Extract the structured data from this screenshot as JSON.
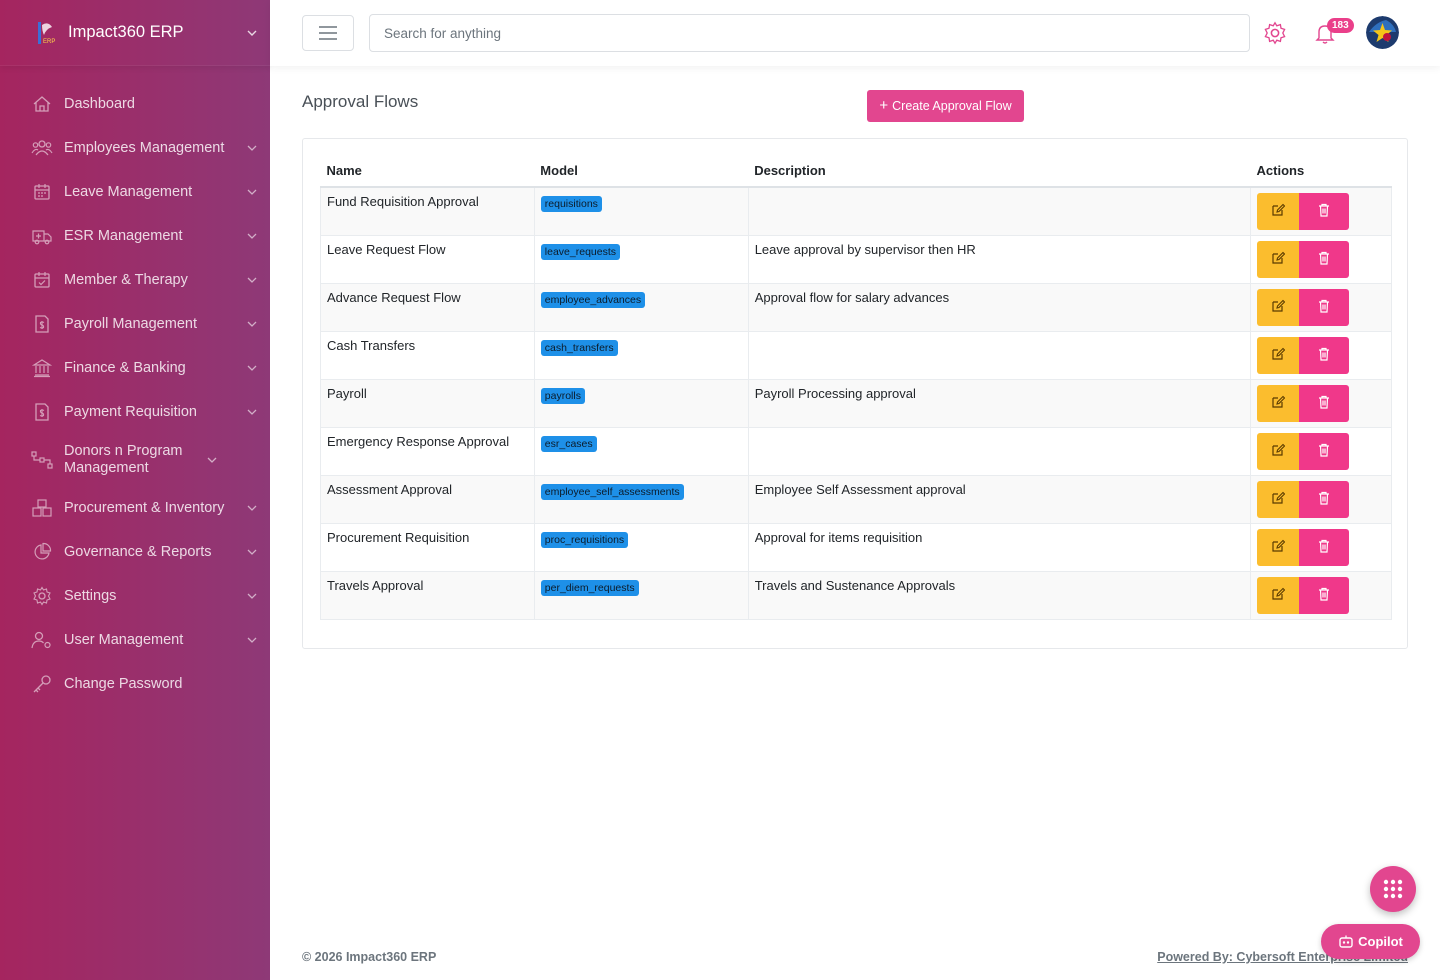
{
  "app": {
    "name": "Impact360 ERP"
  },
  "sidebar": {
    "items": [
      {
        "label": "Dashboard",
        "icon": "home-icon",
        "has_children": false
      },
      {
        "label": "Employees Management",
        "icon": "users-icon",
        "has_children": true
      },
      {
        "label": "Leave Management",
        "icon": "calendar-icon",
        "has_children": true
      },
      {
        "label": "ESR Management",
        "icon": "ambulance-icon",
        "has_children": true
      },
      {
        "label": "Member & Therapy",
        "icon": "calendar-check-icon",
        "has_children": true
      },
      {
        "label": "Payroll Management",
        "icon": "invoice-dollar-icon",
        "has_children": true
      },
      {
        "label": "Finance & Banking",
        "icon": "bank-icon",
        "has_children": true
      },
      {
        "label": "Payment Requisition",
        "icon": "invoice-dollar-icon",
        "has_children": true
      },
      {
        "label": "Donors n Program Management",
        "icon": "hierarchy-icon",
        "has_children": true
      },
      {
        "label": "Procurement & Inventory",
        "icon": "boxes-icon",
        "has_children": true
      },
      {
        "label": "Governance & Reports",
        "icon": "pie-chart-icon",
        "has_children": true
      },
      {
        "label": "Settings",
        "icon": "gear-icon",
        "has_children": true
      },
      {
        "label": "User Management",
        "icon": "user-cog-icon",
        "has_children": true
      },
      {
        "label": "Change Password",
        "icon": "key-icon",
        "has_children": false
      }
    ]
  },
  "topbar": {
    "search_placeholder": "Search for anything",
    "notification_count": "183"
  },
  "main": {
    "title": "Approval Flows",
    "create_button": "Create Approval Flow",
    "table": {
      "headers": [
        "Name",
        "Model",
        "Description",
        "Actions"
      ],
      "rows": [
        {
          "name": "Fund Requisition Approval",
          "model": "requisitions",
          "description": ""
        },
        {
          "name": "Leave Request Flow",
          "model": "leave_requests",
          "description": "Leave approval by supervisor then HR"
        },
        {
          "name": "Advance Request Flow",
          "model": "employee_advances",
          "description": "Approval flow for salary advances"
        },
        {
          "name": "Cash Transfers",
          "model": "cash_transfers",
          "description": ""
        },
        {
          "name": "Payroll",
          "model": "payrolls",
          "description": "Payroll Processing approval"
        },
        {
          "name": "Emergency Response Approval",
          "model": "esr_cases",
          "description": ""
        },
        {
          "name": "Assessment Approval",
          "model": "employee_self_assessments",
          "description": "Employee Self Assessment approval"
        },
        {
          "name": "Procurement Requisition",
          "model": "proc_requisitions",
          "description": "Approval for items requisition"
        },
        {
          "name": "Travels Approval",
          "model": "per_diem_requests",
          "description": "Travels and Sustenance Approvals"
        }
      ]
    }
  },
  "footer": {
    "copyright": "© 2026 Impact360 ERP",
    "powered_by": "Powered By: Cybersoft Enterprise Limited"
  },
  "widgets": {
    "copilot_label": "Copilot"
  },
  "colors": {
    "sidebar_start": "#a5255f",
    "sidebar_end": "#8e3977",
    "primary_pink": "#e2468f",
    "edit_yellow": "#fbbd2e",
    "delete_pink": "#f0388a",
    "tag_blue": "#1e90e8"
  }
}
